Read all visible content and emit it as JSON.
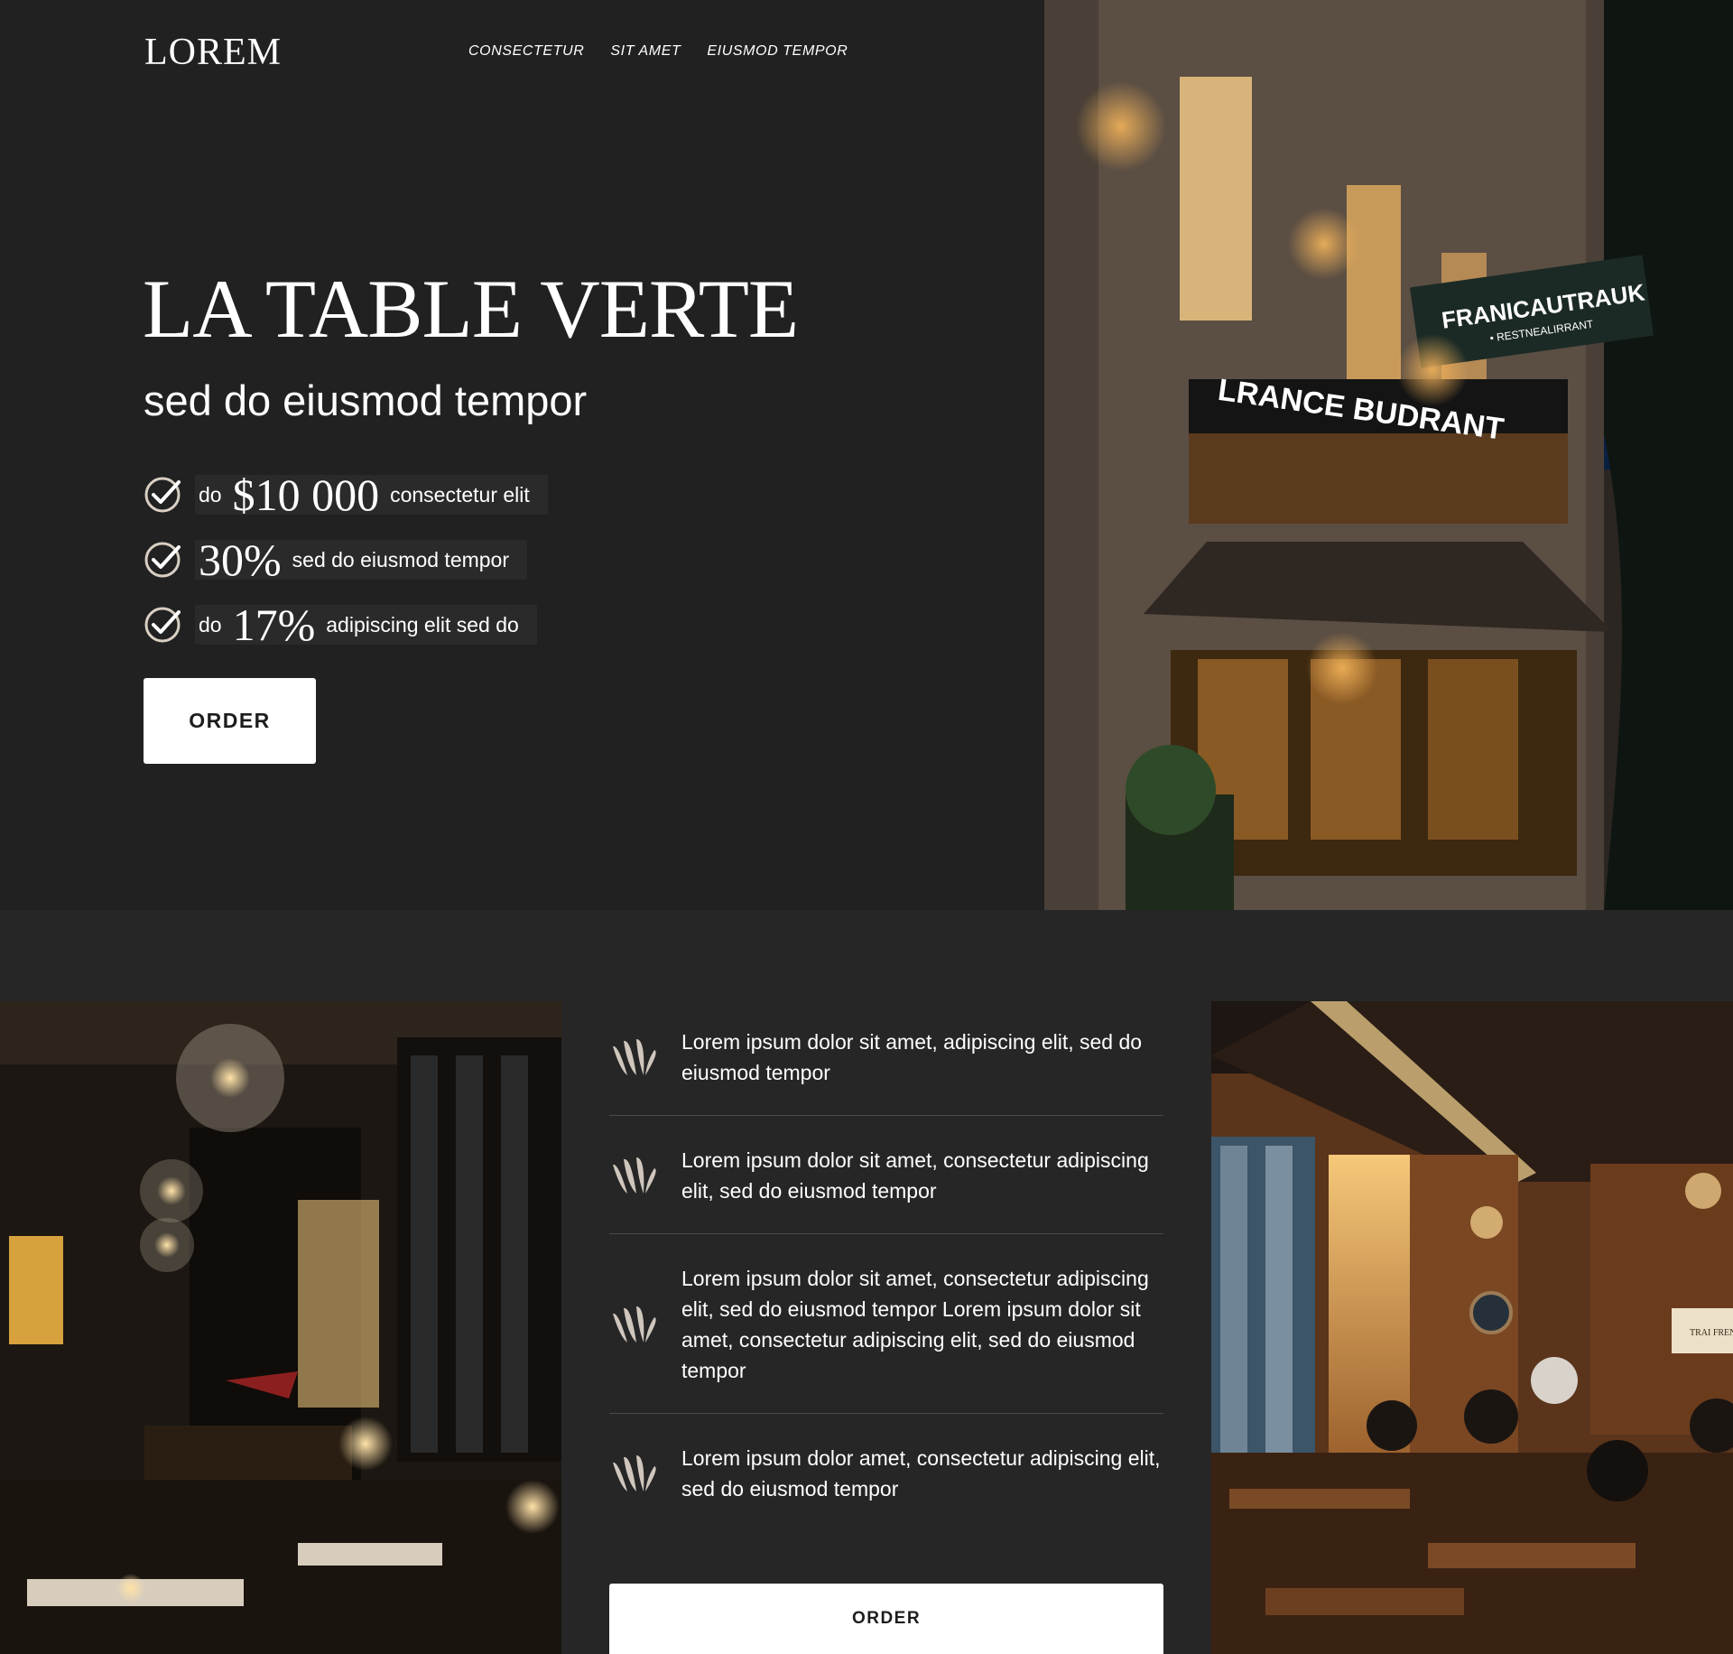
{
  "brand": {
    "logo": "LOREM"
  },
  "nav": {
    "items": [
      "CONSECTETUR",
      "SIT AMET",
      "EIUSMOD TEMPOR"
    ]
  },
  "hero": {
    "title": "LA TABLE VERTE",
    "subtitle": "sed do eiusmod tempor",
    "features": [
      {
        "prefix": "do",
        "value": "$10 000",
        "text": "consectetur elit"
      },
      {
        "prefix": "",
        "value": "30%",
        "text": "sed do eiusmod tempor"
      },
      {
        "prefix": "do",
        "value": "17%",
        "text": "adipiscing elit sed do"
      }
    ],
    "order_label": "ORDER"
  },
  "benefits": {
    "items": [
      "Lorem ipsum dolor sit amet, adipiscing elit, sed do eiusmod tempor",
      "Lorem ipsum dolor sit amet, consectetur adipiscing elit, sed do eiusmod tempor",
      "Lorem ipsum dolor sit amet, consectetur adipiscing elit, sed do eiusmod tempor Lorem ipsum dolor sit amet, consectetur adipiscing elit, sed do eiusmod tempor",
      "Lorem ipsum dolor amet, consectetur adipiscing elit, sed do eiusmod tempor"
    ],
    "order_label": "ORDER"
  },
  "images": {
    "facade_sign_top": "FRANICAUTRAUK",
    "facade_sign_top_sub": "• RESTNEALIRRANT",
    "facade_sign_main": "LRANCE BUDRANT",
    "interior_right_frame_text": "TRAI FREN"
  },
  "colors": {
    "background": "#262626",
    "hero_background": "#212122",
    "check_ring": "#d9cfc3",
    "icon_leaf": "#cfc6bd",
    "button": "#ffffff",
    "button_text": "#1d1d1d"
  }
}
